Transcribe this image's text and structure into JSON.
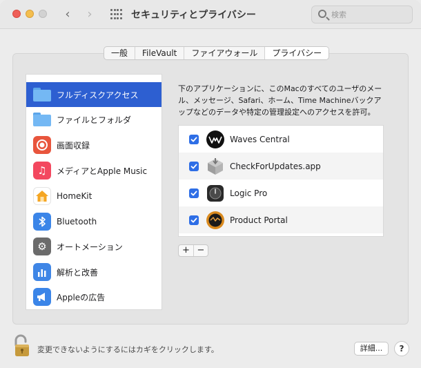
{
  "window": {
    "title": "セキュリティとプライバシー",
    "back_glyph": "‹",
    "forward_glyph": "›"
  },
  "search": {
    "placeholder": "検索",
    "value": ""
  },
  "tabs": [
    {
      "label": "一般",
      "active": false
    },
    {
      "label": "FileVault",
      "active": false
    },
    {
      "label": "ファイアウォール",
      "active": false
    },
    {
      "label": "プライバシー",
      "active": true
    }
  ],
  "sidebar": {
    "items": [
      {
        "label": "フルディスクアクセス",
        "icon": "folder-icon",
        "selected": true
      },
      {
        "label": "ファイルとフォルダ",
        "icon": "folder-icon",
        "selected": false
      },
      {
        "label": "画面収録",
        "icon": "screen-record-icon",
        "selected": false
      },
      {
        "label": "メディアとApple Music",
        "icon": "music-note-icon",
        "selected": false
      },
      {
        "label": "HomeKit",
        "icon": "home-icon",
        "selected": false
      },
      {
        "label": "Bluetooth",
        "icon": "bluetooth-icon",
        "selected": false
      },
      {
        "label": "オートメーション",
        "icon": "gear-icon",
        "selected": false
      },
      {
        "label": "解析と改善",
        "icon": "bar-chart-icon",
        "selected": false
      },
      {
        "label": "Appleの広告",
        "icon": "megaphone-icon",
        "selected": false
      }
    ]
  },
  "main": {
    "description": "下のアプリケーションに、このMacのすべてのユーザのメール、メッセージ、Safari、ホーム、Time Machineバックアップなどのデータや特定の管理設定へのアクセスを許可。",
    "apps": [
      {
        "name": "Waves Central",
        "checked": true,
        "icon": "waves-logo-icon"
      },
      {
        "name": "CheckForUpdates.app",
        "checked": true,
        "icon": "installer-icon"
      },
      {
        "name": "Logic Pro",
        "checked": true,
        "icon": "logic-pro-icon"
      },
      {
        "name": "Product Portal",
        "checked": true,
        "icon": "product-portal-icon"
      }
    ],
    "add_label": "+",
    "remove_label": "−"
  },
  "footer": {
    "lock_text": "変更できないようにするにはカギをクリックします。",
    "details_label": "詳細...",
    "help_label": "?"
  },
  "colors": {
    "accent": "#2d5fd1",
    "checkbox": "#2e6ee6",
    "close": "#ee5f58",
    "minimize": "#f4be4f"
  }
}
